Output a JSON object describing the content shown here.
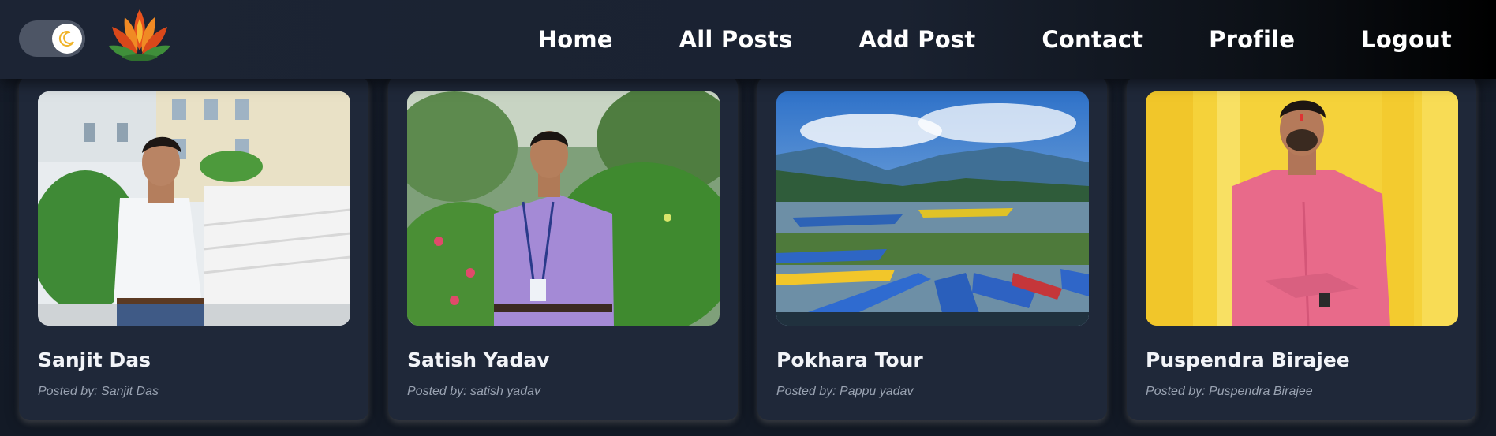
{
  "theme_toggle": {
    "icon": "moon-icon"
  },
  "logo": {
    "icon": "lotus-logo-icon"
  },
  "nav": {
    "items": [
      "Home",
      "All Posts",
      "Add Post",
      "Contact",
      "Profile",
      "Logout"
    ]
  },
  "posts": [
    {
      "title": "Sanjit Das",
      "meta": "Posted by: Sanjit Das",
      "image_icon": "portrait-photo"
    },
    {
      "title": "Satish Yadav",
      "meta": "Posted by: satish yadav",
      "image_icon": "portrait-photo"
    },
    {
      "title": "Pokhara Tour",
      "meta": "Posted by: Pappu yadav",
      "image_icon": "landscape-photo"
    },
    {
      "title": "Puspendra Birajee",
      "meta": "Posted by: Puspendra Birajee",
      "image_icon": "portrait-photo"
    }
  ],
  "colors": {
    "background": "#151c29",
    "card": "#1f2839",
    "accent": "#f5c242"
  }
}
